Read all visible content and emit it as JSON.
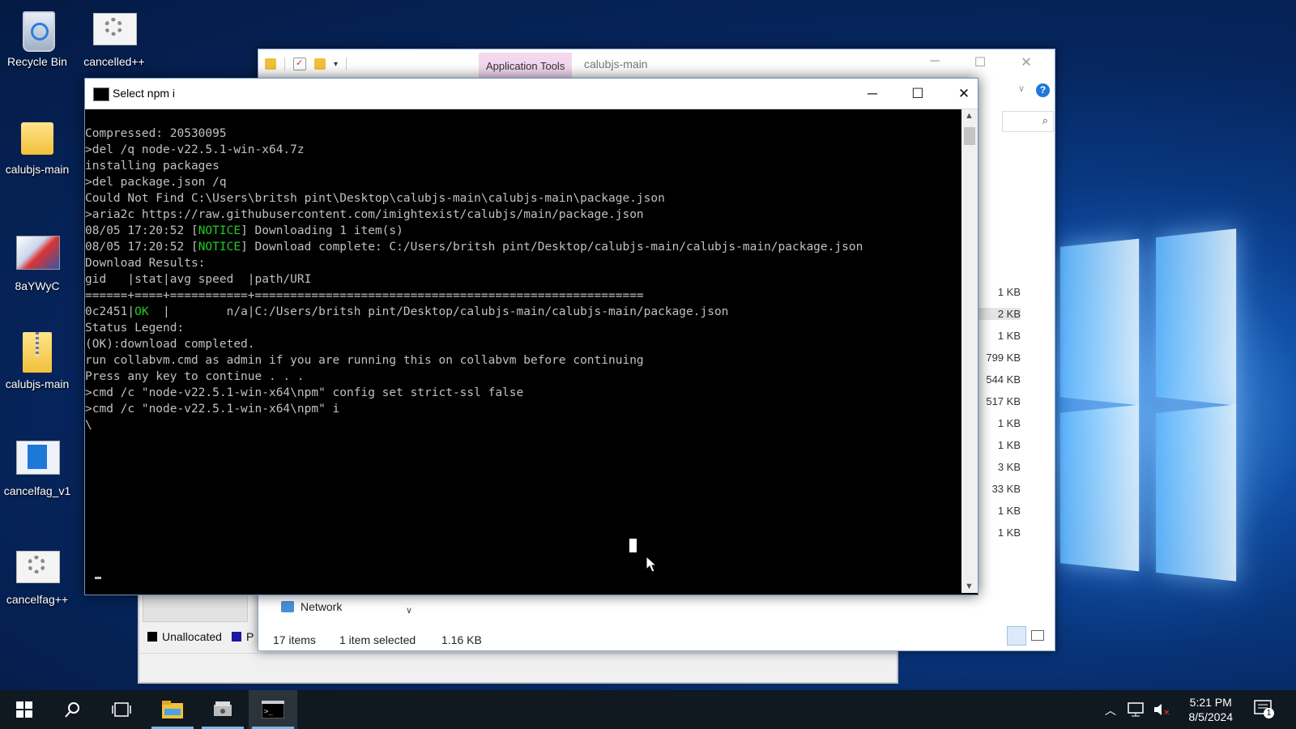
{
  "desktop": {
    "icons": [
      {
        "label": "Recycle Bin"
      },
      {
        "label": "cancelled++"
      },
      {
        "label": "calubjs-main"
      },
      {
        "label": "8aYWyC"
      },
      {
        "label": "calubjs-main"
      },
      {
        "label": "cancelfag_v1"
      },
      {
        "label": "cancelfag++"
      }
    ]
  },
  "explorer": {
    "app_tools": "Application Tools",
    "title": "calubjs-main",
    "sizes": [
      "1 KB",
      "2 KB",
      "1 KB",
      "799 KB",
      "544 KB",
      "517 KB",
      "1 KB",
      "1 KB",
      "3 KB",
      "33 KB",
      "1 KB",
      "1 KB"
    ],
    "nav_network": "Network",
    "status_items": "17 items",
    "status_selected": "1 item selected",
    "status_size": "1.16 KB"
  },
  "diskmgmt": {
    "legend_unallocated": "Unallocated",
    "legend_p": "P"
  },
  "cmd": {
    "title": "Select npm i",
    "lines": [
      "Compressed: 20530095",
      "",
      ">del /q node-v22.5.1-win-x64.7z",
      "",
      "installing packages",
      "",
      ">del package.json /q",
      "Could Not Find C:\\Users\\britsh pint\\Desktop\\calubjs-main\\calubjs-main\\package.json",
      "",
      ">aria2c https://raw.githubusercontent.com/imightexist/calubjs/main/package.json",
      "",
      "08/05 17:20:52 [NOTICE] Downloading 1 item(s)",
      "",
      "08/05 17:20:52 [NOTICE] Download complete: C:/Users/britsh pint/Desktop/calubjs-main/calubjs-main/package.json",
      "",
      "Download Results:",
      "gid   |stat|avg speed  |path/URI",
      "======+====+===========+=======================================================",
      "0c2451|OK  |        n/a|C:/Users/britsh pint/Desktop/calubjs-main/calubjs-main/package.json",
      "",
      "Status Legend:",
      "(OK):download completed.",
      "",
      "run collabvm.cmd as admin if you are running this on collabvm before continuing",
      "Press any key to continue . . .",
      "",
      ">cmd /c \"node-v22.5.1-win-x64\\npm\" config set strict-ssl false",
      "",
      ">cmd /c \"node-v22.5.1-win-x64\\npm\" i",
      "\\"
    ]
  },
  "taskbar": {
    "time": "5:21 PM",
    "date": "8/5/2024",
    "notification_count": "1"
  },
  "colors": {
    "notice_green": "#22cc22",
    "console_text": "#c0c0c0",
    "accent": "#76b9ed"
  }
}
